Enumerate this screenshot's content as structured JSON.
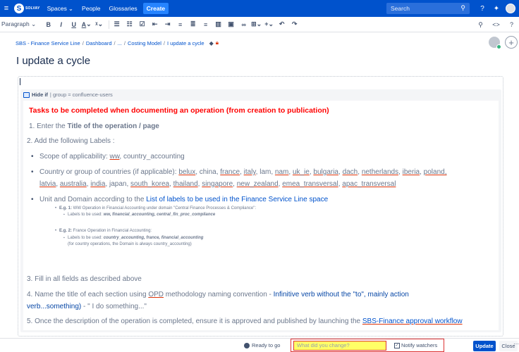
{
  "topnav": {
    "brand_word": "SOLVAY",
    "items": [
      "Spaces",
      "People",
      "Glossaries"
    ],
    "create_label": "Create",
    "search_placeholder": "Search"
  },
  "toolbar": {
    "paragraph_label": "Paragraph"
  },
  "breadcrumb": [
    "SBS - Finance Service Line",
    "Dashboard",
    "...",
    "Costing Model",
    "I update a cycle"
  ],
  "page_title": "I update a cycle",
  "macro": {
    "label": "Hide if",
    "condition": "| group = confluence-users"
  },
  "content": {
    "heading": "Tasks to be completed when documenting an operation (from creation to publication)",
    "step1_prefix": "1. Enter the ",
    "step1_bold": "Title of the operation / page",
    "step2": "2. Add the following  Labels :",
    "scope_prefix": "Scope of applicability: ",
    "scope_ww": "ww",
    "scope_rest": ", country_accounting",
    "country_prefix": "Country or group of countries (if applicable): ",
    "country_line1_items": [
      "belux",
      "china",
      "france",
      "italy",
      "lam",
      "nam",
      "uk_ie",
      "bulgaria",
      "dach",
      "netherlands",
      "iberia",
      "poland,"
    ],
    "country_line2": [
      "latvia",
      "australia",
      "india",
      "japan",
      "south_korea",
      "thailand",
      "singapore",
      "new_zealand",
      "emea_transversal",
      "apac_transversal"
    ],
    "unit_prefix": "Unit and Domain according to the ",
    "unit_link": "List of labels to be used in the Finance Service Line space",
    "eg1_label": "E.g. 1:",
    "eg1_text": " WW Operation in Financial Accounting under domain \"Central Finance Processes & Compliance\":",
    "eg1_sub_prefix": "Labels to be used: ",
    "eg1_sub_values": "ww, financial_accounting, central_fin_proc_compliance",
    "eg2_label": "E.g. 2:",
    "eg2_text": " France Operation in Financial Accounting:",
    "eg2_sub_prefix": "Labels to be used: ",
    "eg2_sub_values": "country_accounting, france, financial_accounting",
    "eg2_note": "(for country operations, the Domain is always country_accounting)",
    "step3": "3. Fill in all fields as described above",
    "step4_prefix": "4. Name the title of each section using ",
    "step4_opd": "OPD",
    "step4_mid": " methodology naming convention - ",
    "step4_dark": "Infinitive verb without the \"to\", mainly action",
    "step4_line2_dark": "verb...something)",
    "step4_line2_rest": " - \" I do something...\"",
    "step5_prefix": "5. Once the description of the operation is completed, ensure it is approved and published by launching the ",
    "step5_link": "SBS-Finance approval workflow"
  },
  "bottombar": {
    "ready": "Ready to go",
    "change_placeholder": "What did you change?",
    "notify": "Notify watchers",
    "update": "Update",
    "close": "Close",
    "more": "···"
  }
}
